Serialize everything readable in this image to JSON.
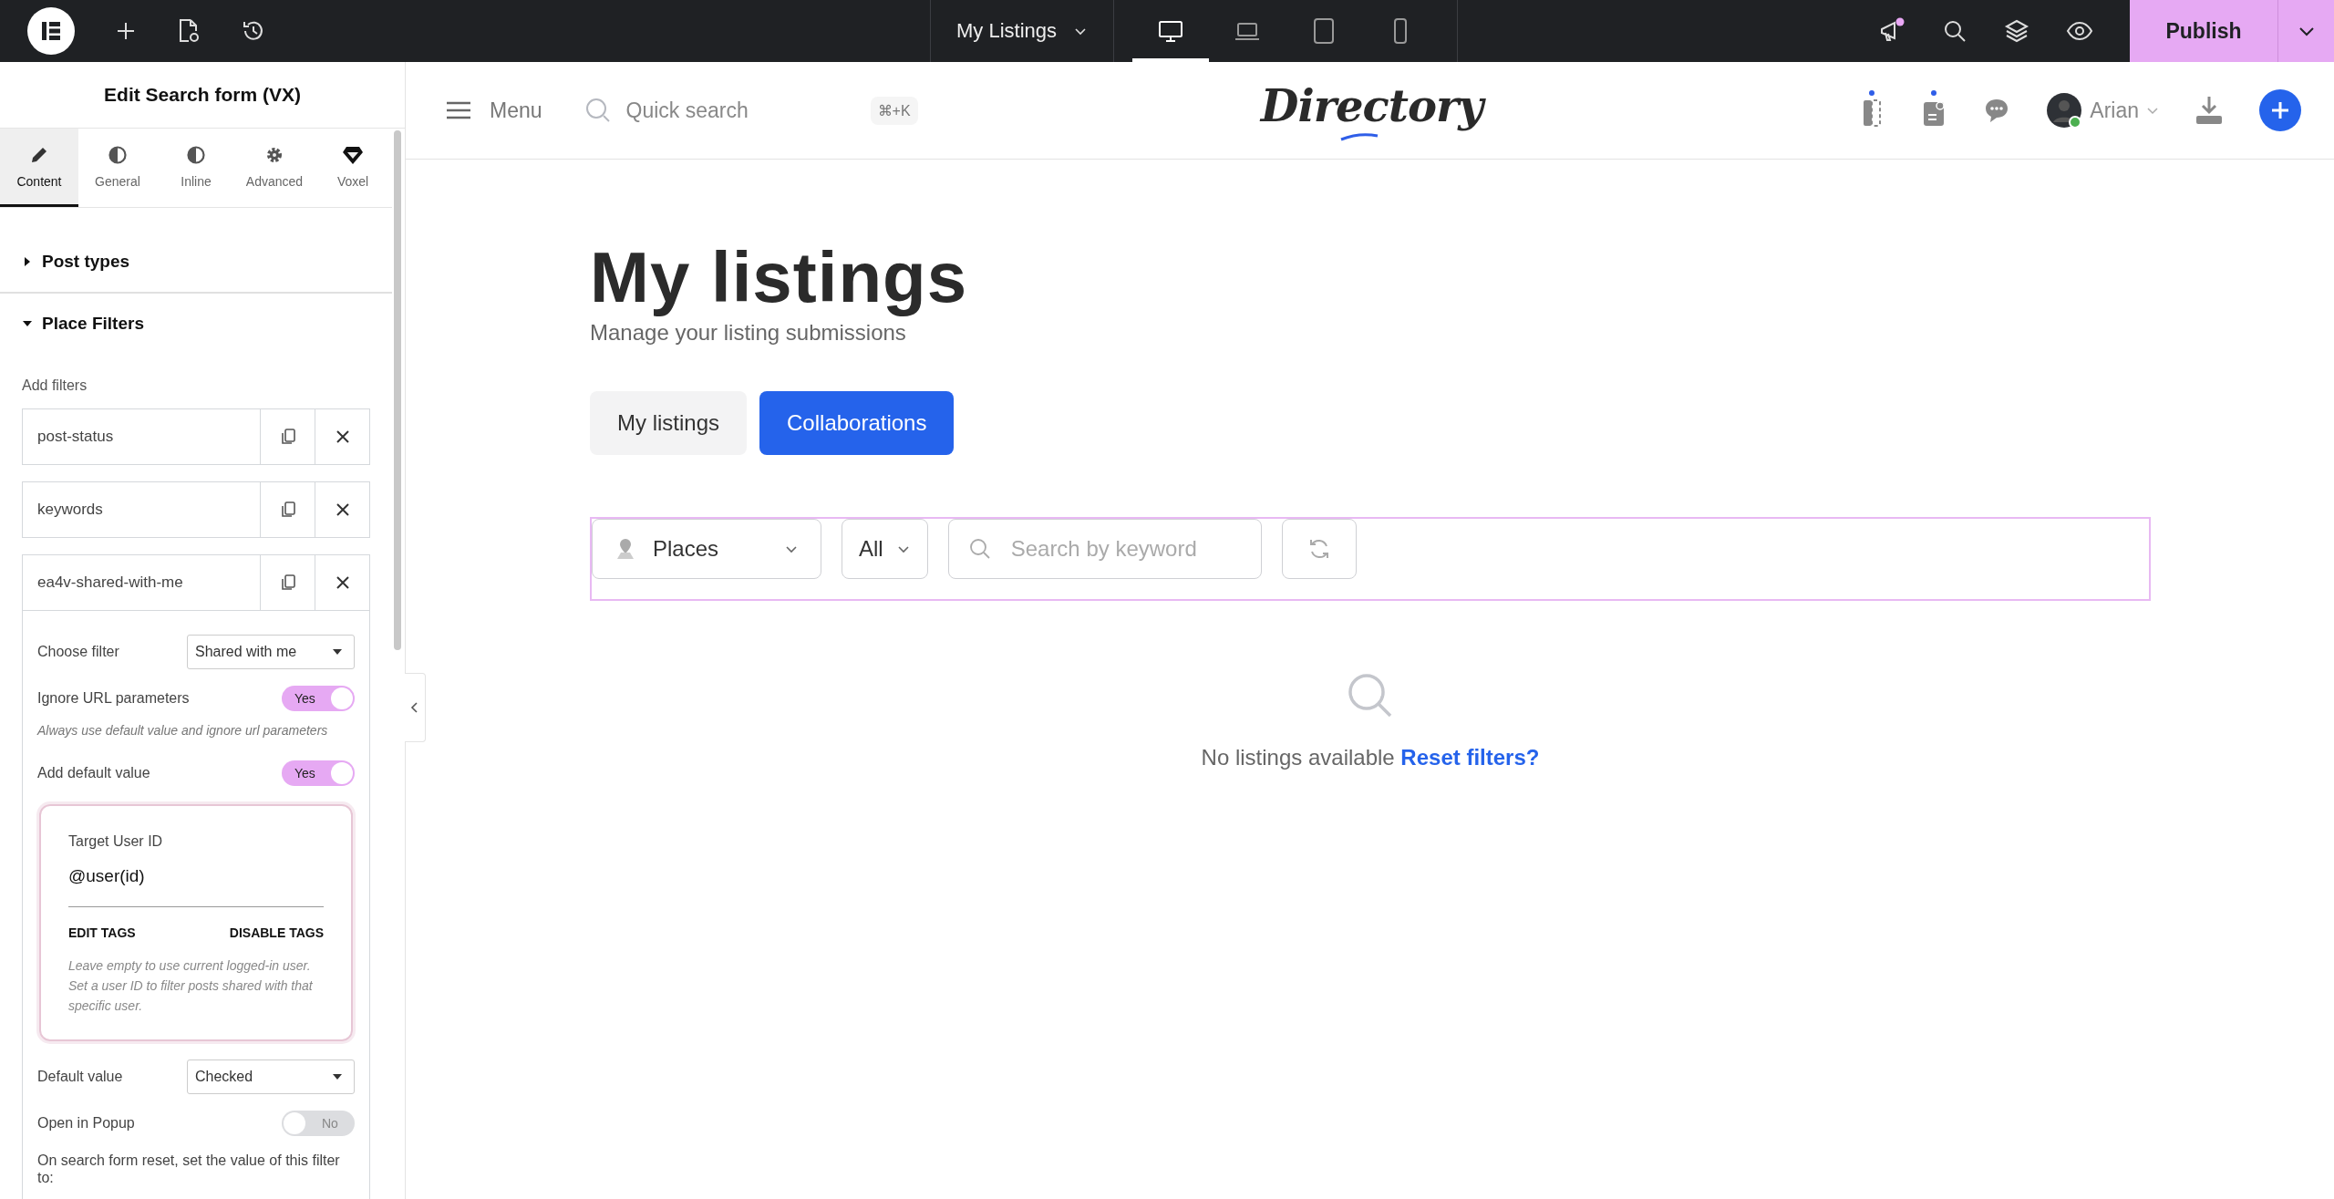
{
  "topbar": {
    "page_title": "My Listings",
    "devices": [
      {
        "kind": "desktop",
        "selected": true
      },
      {
        "kind": "laptop",
        "selected": false
      },
      {
        "kind": "tablet",
        "selected": false
      },
      {
        "kind": "mobile",
        "selected": false
      }
    ],
    "notification": true,
    "publish": "Publish"
  },
  "panel": {
    "title": "Edit Search form (VX)",
    "tabs": [
      {
        "label": "Content",
        "selected": true
      },
      {
        "label": "General",
        "selected": false
      },
      {
        "label": "Inline",
        "selected": false
      },
      {
        "label": "Advanced",
        "selected": false
      },
      {
        "label": "Voxel",
        "selected": false
      }
    ],
    "sections": [
      {
        "title": "Post types",
        "expanded": false
      },
      {
        "title": "Place Filters",
        "expanded": true
      }
    ],
    "add_filters_label": "Add filters",
    "filters": [
      "post-status",
      "keywords",
      "ea4v-shared-with-me"
    ],
    "settings": [
      {
        "kind": "select",
        "label": "Choose filter",
        "value": "Shared with me"
      },
      {
        "kind": "toggle",
        "label": "Ignore URL parameters",
        "on": true,
        "text": "Yes"
      },
      {
        "kind": "help",
        "text": "Always use default value and ignore url parameters"
      },
      {
        "kind": "toggle",
        "label": "Add default value",
        "on": true,
        "text": "Yes"
      },
      {
        "kind": "card",
        "label": "Target User ID",
        "value": "@user(id)",
        "actions": [
          "EDIT TAGS",
          "DISABLE TAGS"
        ],
        "help": "Leave empty to use current logged-in user. Set a user ID to filter posts shared with that specific user."
      },
      {
        "kind": "select",
        "label": "Default value",
        "value": "Checked"
      },
      {
        "kind": "toggle",
        "label": "Open in Popup",
        "on": false,
        "text": "No"
      },
      {
        "kind": "note",
        "text": "On search form reset, set the value of this filter to:"
      }
    ]
  },
  "site": {
    "menu": "Menu",
    "search_placeholder": "Quick search",
    "shortcut": "⌘+K",
    "logo": "Directory",
    "user": "Arian"
  },
  "page": {
    "title": "My listings",
    "subtitle": "Manage your listing submissions",
    "tabs": [
      {
        "label": "My listings",
        "selected": false
      },
      {
        "label": "Collaborations",
        "selected": true
      }
    ],
    "filters": {
      "post_type": "Places",
      "status": "All",
      "keyword_placeholder": "Search by keyword"
    },
    "empty": {
      "text": "No listings available",
      "link": "Reset filters?"
    }
  }
}
